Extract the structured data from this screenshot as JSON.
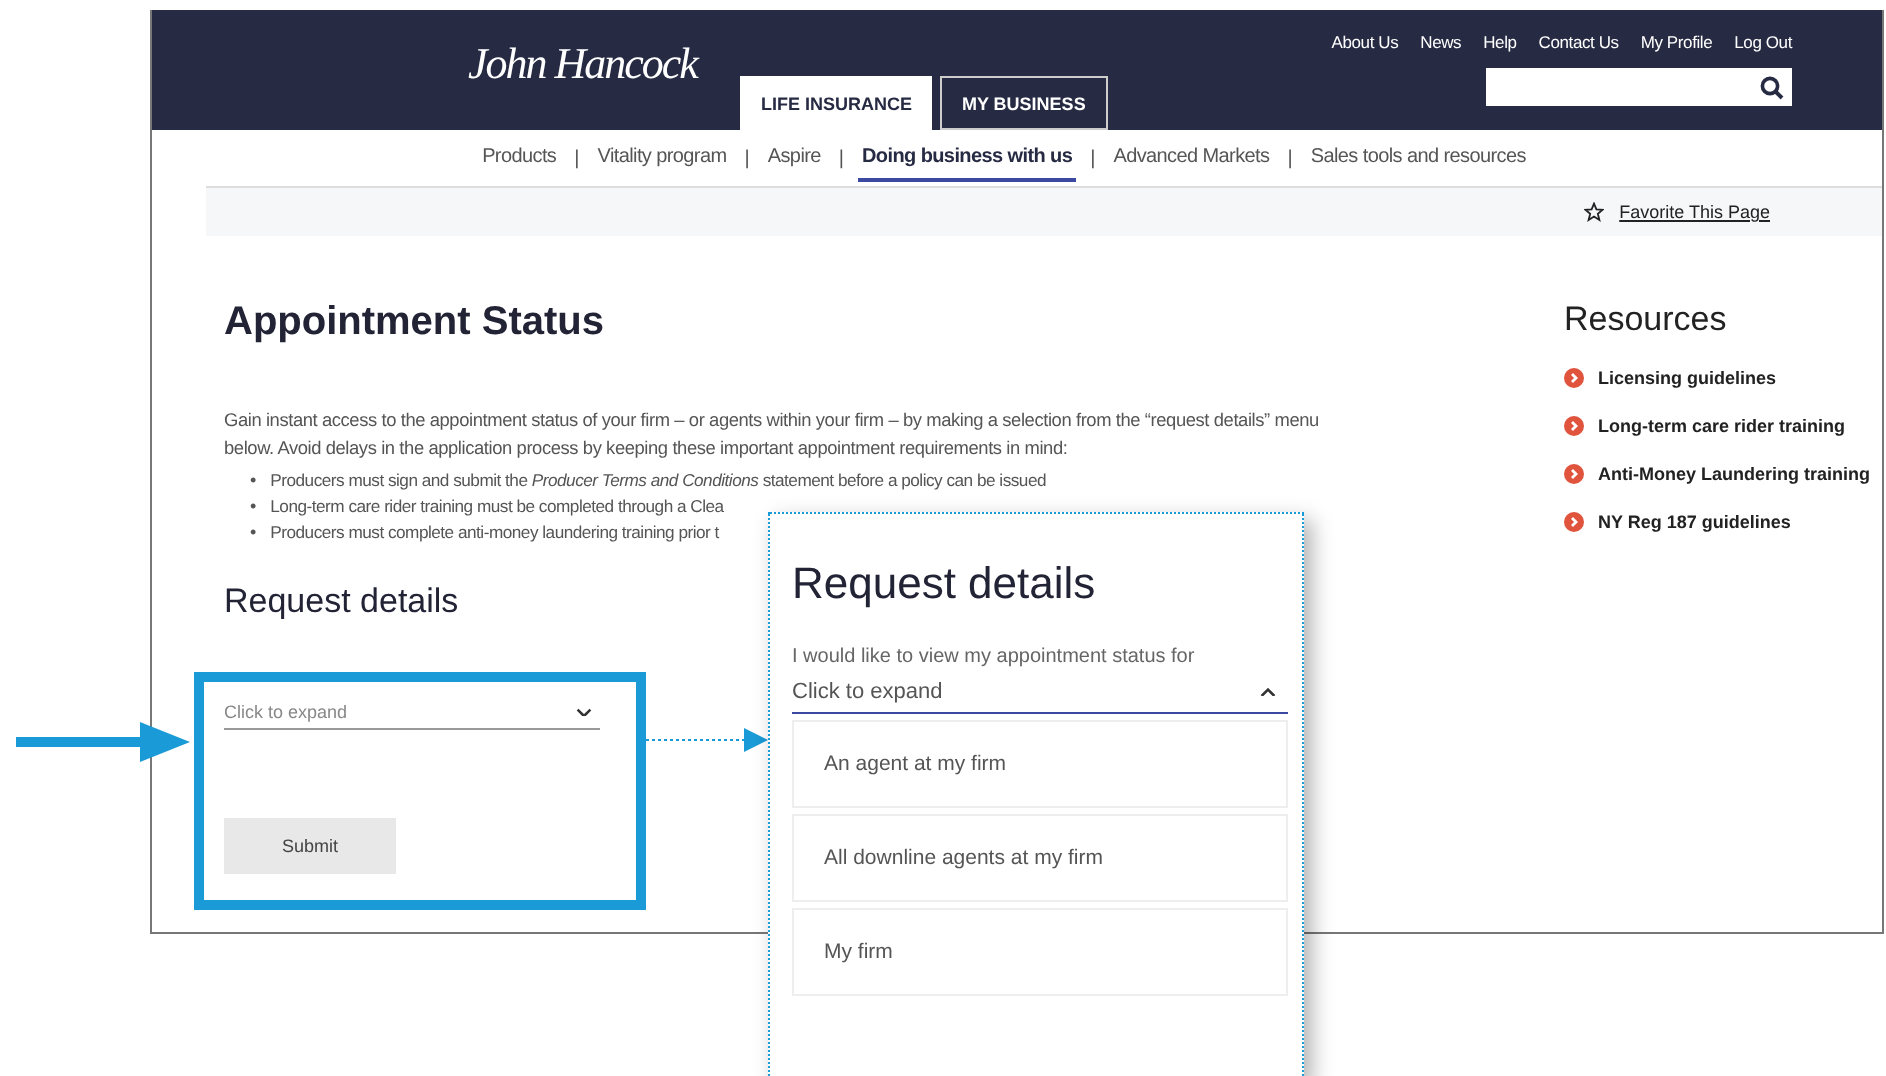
{
  "header": {
    "logo": "John Hancock",
    "top_links": [
      "About Us",
      "News",
      "Help",
      "Contact Us",
      "My Profile",
      "Log Out"
    ],
    "tabs": [
      {
        "label": "LIFE INSURANCE",
        "selected": true
      },
      {
        "label": "MY BUSINESS",
        "selected": false
      }
    ]
  },
  "nav": {
    "separator": "|",
    "items": [
      {
        "label": "Products",
        "selected": false
      },
      {
        "label": "Vitality program",
        "selected": false
      },
      {
        "label": "Aspire",
        "selected": false
      },
      {
        "label": "Doing business with us",
        "selected": true
      },
      {
        "label": "Advanced Markets",
        "selected": false
      },
      {
        "label": "Sales tools and resources",
        "selected": false
      }
    ]
  },
  "favorite": {
    "label": "Favorite This Page"
  },
  "main": {
    "title": "Appointment Status",
    "intro": "Gain instant access to the appointment status of your firm – or agents within your firm – by making a selection from the “request details” menu below. Avoid delays in the application process by keeping these important appointment requirements in mind:",
    "bullet_marker": "•",
    "bullets": [
      "Producers must sign and submit the *Producer Terms and Conditions* statement before a policy can be issued",
      "Long-term care rider training must be completed through a Clea",
      "Producers must complete anti-money laundering training prior t"
    ],
    "form": {
      "heading": "Request details",
      "select": {
        "value": "Click to expand",
        "expanded": false
      },
      "submit": "Submit"
    }
  },
  "resources": {
    "title": "Resources",
    "items": [
      "Licensing guidelines",
      "Long-term care rider training",
      "Anti-Money Laundering training",
      "NY Reg 187 guidelines"
    ]
  },
  "callout": {
    "heading": "Request details",
    "label": "I would like to view my appointment status for",
    "select": {
      "value": "Click to expand",
      "expanded": true
    },
    "options": [
      "An agent at my firm",
      "All downline agents at my firm",
      "My firm"
    ]
  }
}
